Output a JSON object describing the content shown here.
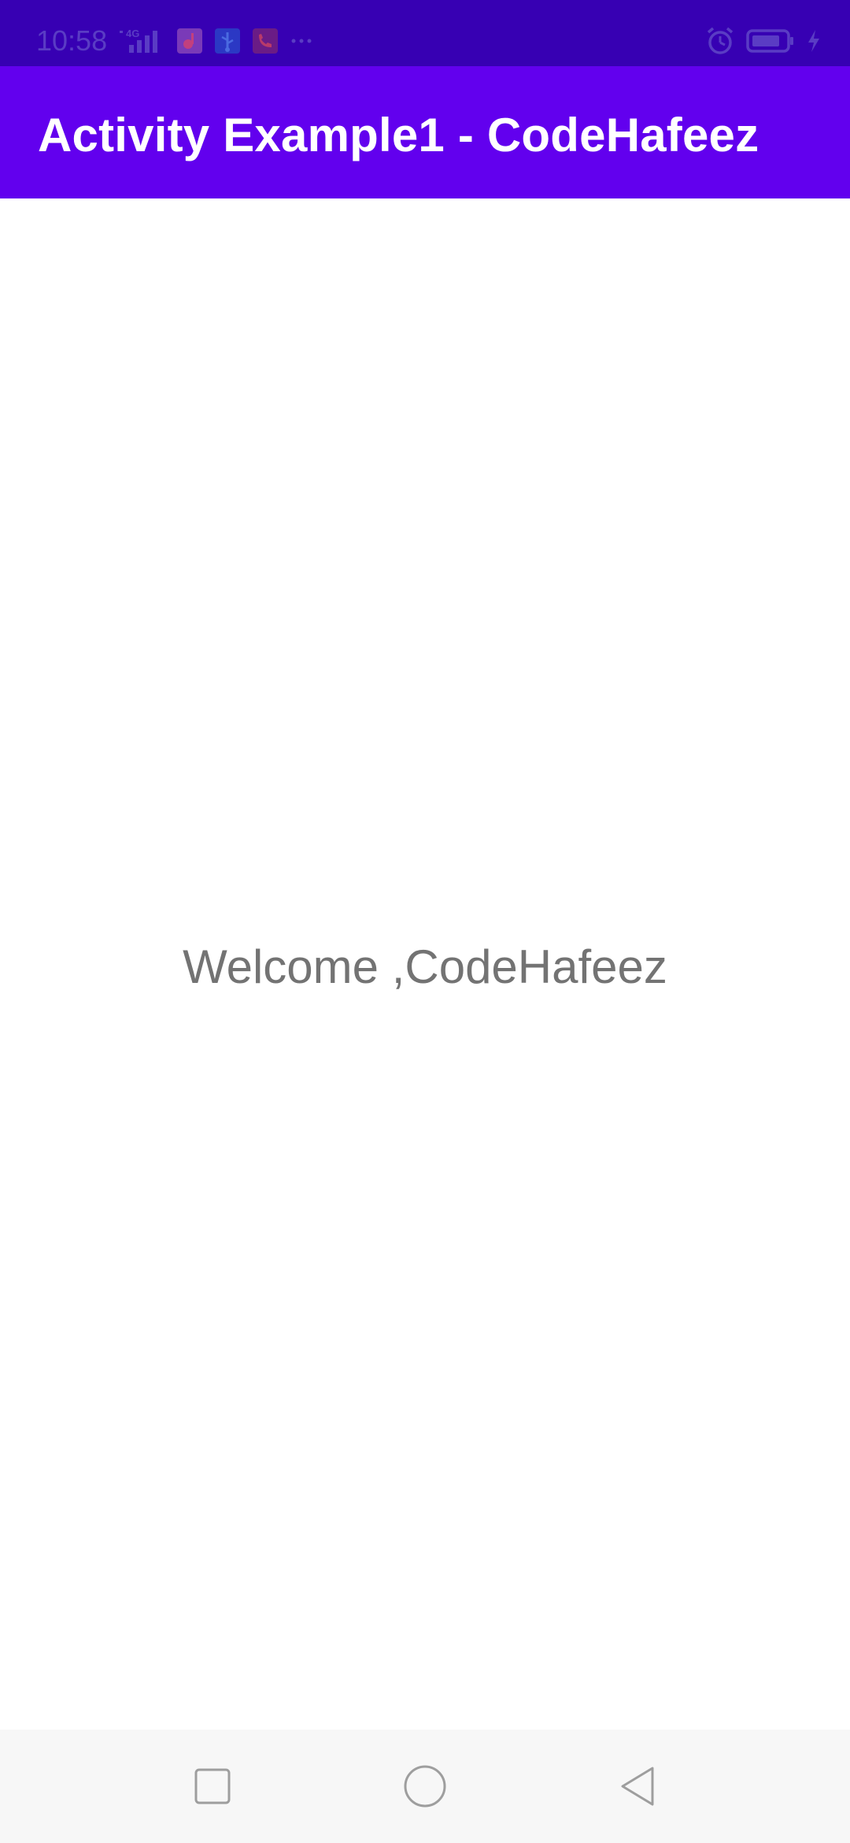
{
  "status_bar": {
    "time": "10:58",
    "network": "4G",
    "icons": [
      "signal-icon",
      "app-notification-icon",
      "usb-icon",
      "call-notification-icon",
      "more-notifications-icon",
      "alarm-icon",
      "battery-icon",
      "charging-icon"
    ],
    "background": "#3700b3"
  },
  "app_bar": {
    "title": "Activity Example1 - CodeHafeez",
    "background": "#6200ee"
  },
  "content": {
    "welcome": "Welcome ,CodeHafeez"
  },
  "nav_bar": {
    "buttons": [
      "recent-apps",
      "home",
      "back"
    ]
  }
}
